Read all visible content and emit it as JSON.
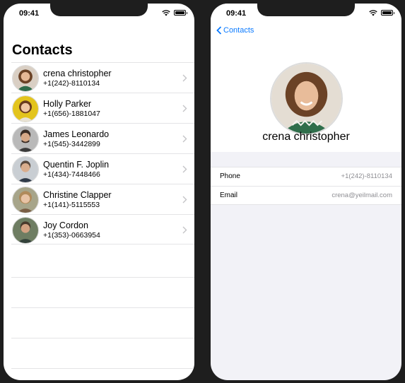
{
  "left_screen": {
    "status": {
      "time": "09:41"
    },
    "title": "Contacts",
    "contacts": [
      {
        "name": "crena christopher",
        "phone": "+1(242)-8110134",
        "avatar_bg": "#8c6b4f"
      },
      {
        "name": "Holly Parker",
        "phone": "+1(656)-1881047",
        "avatar_bg": "#e3c41d"
      },
      {
        "name": "James Leonardo",
        "phone": "+1(545)-3442899",
        "avatar_bg": "#b9b9b9"
      },
      {
        "name": "Quentin F. Joplin",
        "phone": "+1(434)-7448466",
        "avatar_bg": "#c9ced3"
      },
      {
        "name": "Christine Clapper",
        "phone": "+1(141)-5115553",
        "avatar_bg": "#a7a58a"
      },
      {
        "name": "Joy Cordon",
        "phone": "+1(353)-0663954",
        "avatar_bg": "#6e7d62"
      }
    ]
  },
  "right_screen": {
    "status": {
      "time": "09:41"
    },
    "back_label": "Contacts",
    "name": "crena christopher",
    "fields": [
      {
        "label": "Phone",
        "value": "+1(242)-8110134"
      },
      {
        "label": "Email",
        "value": "crena@yeilmail.com"
      }
    ]
  },
  "colors": {
    "accent": "#0a7aff",
    "secondary_text": "#8e8e93",
    "separator": "#e4e4e6"
  }
}
